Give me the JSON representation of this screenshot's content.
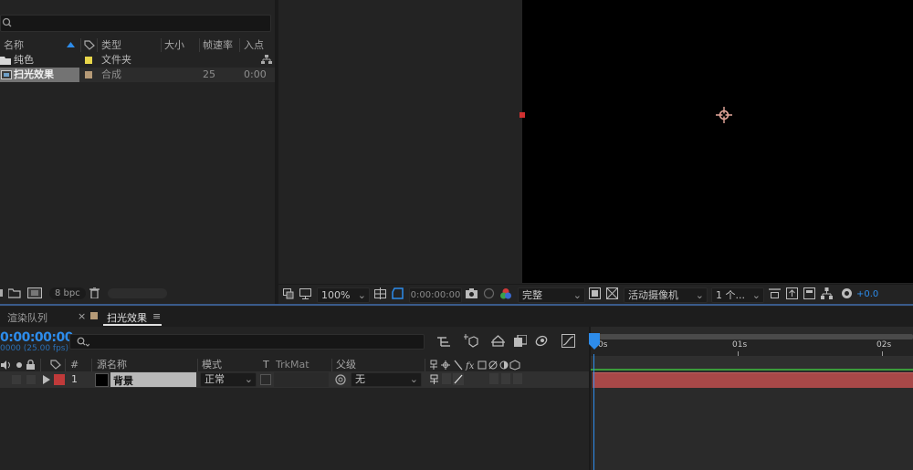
{
  "project": {
    "columns": {
      "name": "名称",
      "type": "类型",
      "size": "大小",
      "fps": "帧速率",
      "in": "入点"
    },
    "items": [
      {
        "name": "纯色",
        "type": "文件夹",
        "fps": "",
        "in": "",
        "label_color": "#e8d64a"
      },
      {
        "name": "扫光效果",
        "type": "合成",
        "fps": "25",
        "in": "0:00",
        "label_color": "#b59a77"
      }
    ],
    "footer": {
      "bpc": "8 bpc"
    }
  },
  "viewer": {
    "zoom": "100%",
    "timecode": "0:00:00:00",
    "resolution": "完整",
    "camera": "活动摄像机",
    "views": "1 个...",
    "exposure": "+0.0"
  },
  "timeline": {
    "tabs": [
      {
        "label": "渲染队列"
      },
      {
        "label": "扫光效果",
        "close": "×",
        "menu": "≡"
      }
    ],
    "timecode": "0:00:00:00",
    "fps_label": "0000 (25.00 fps)",
    "columns": {
      "num": "#",
      "source": "源名称",
      "mode": "模式",
      "t": "T",
      "trkmat": "TrkMat",
      "parent": "父级"
    },
    "layers": [
      {
        "num": "1",
        "name": "背景",
        "mode": "正常",
        "parent": "无",
        "label_color": "#c03a3a"
      }
    ],
    "ruler": [
      "0s",
      "01s",
      "02s"
    ],
    "colors": {
      "accent": "#2d8ceb",
      "layer_bar": "#a84848",
      "work_area": "#3a9a3a"
    }
  }
}
